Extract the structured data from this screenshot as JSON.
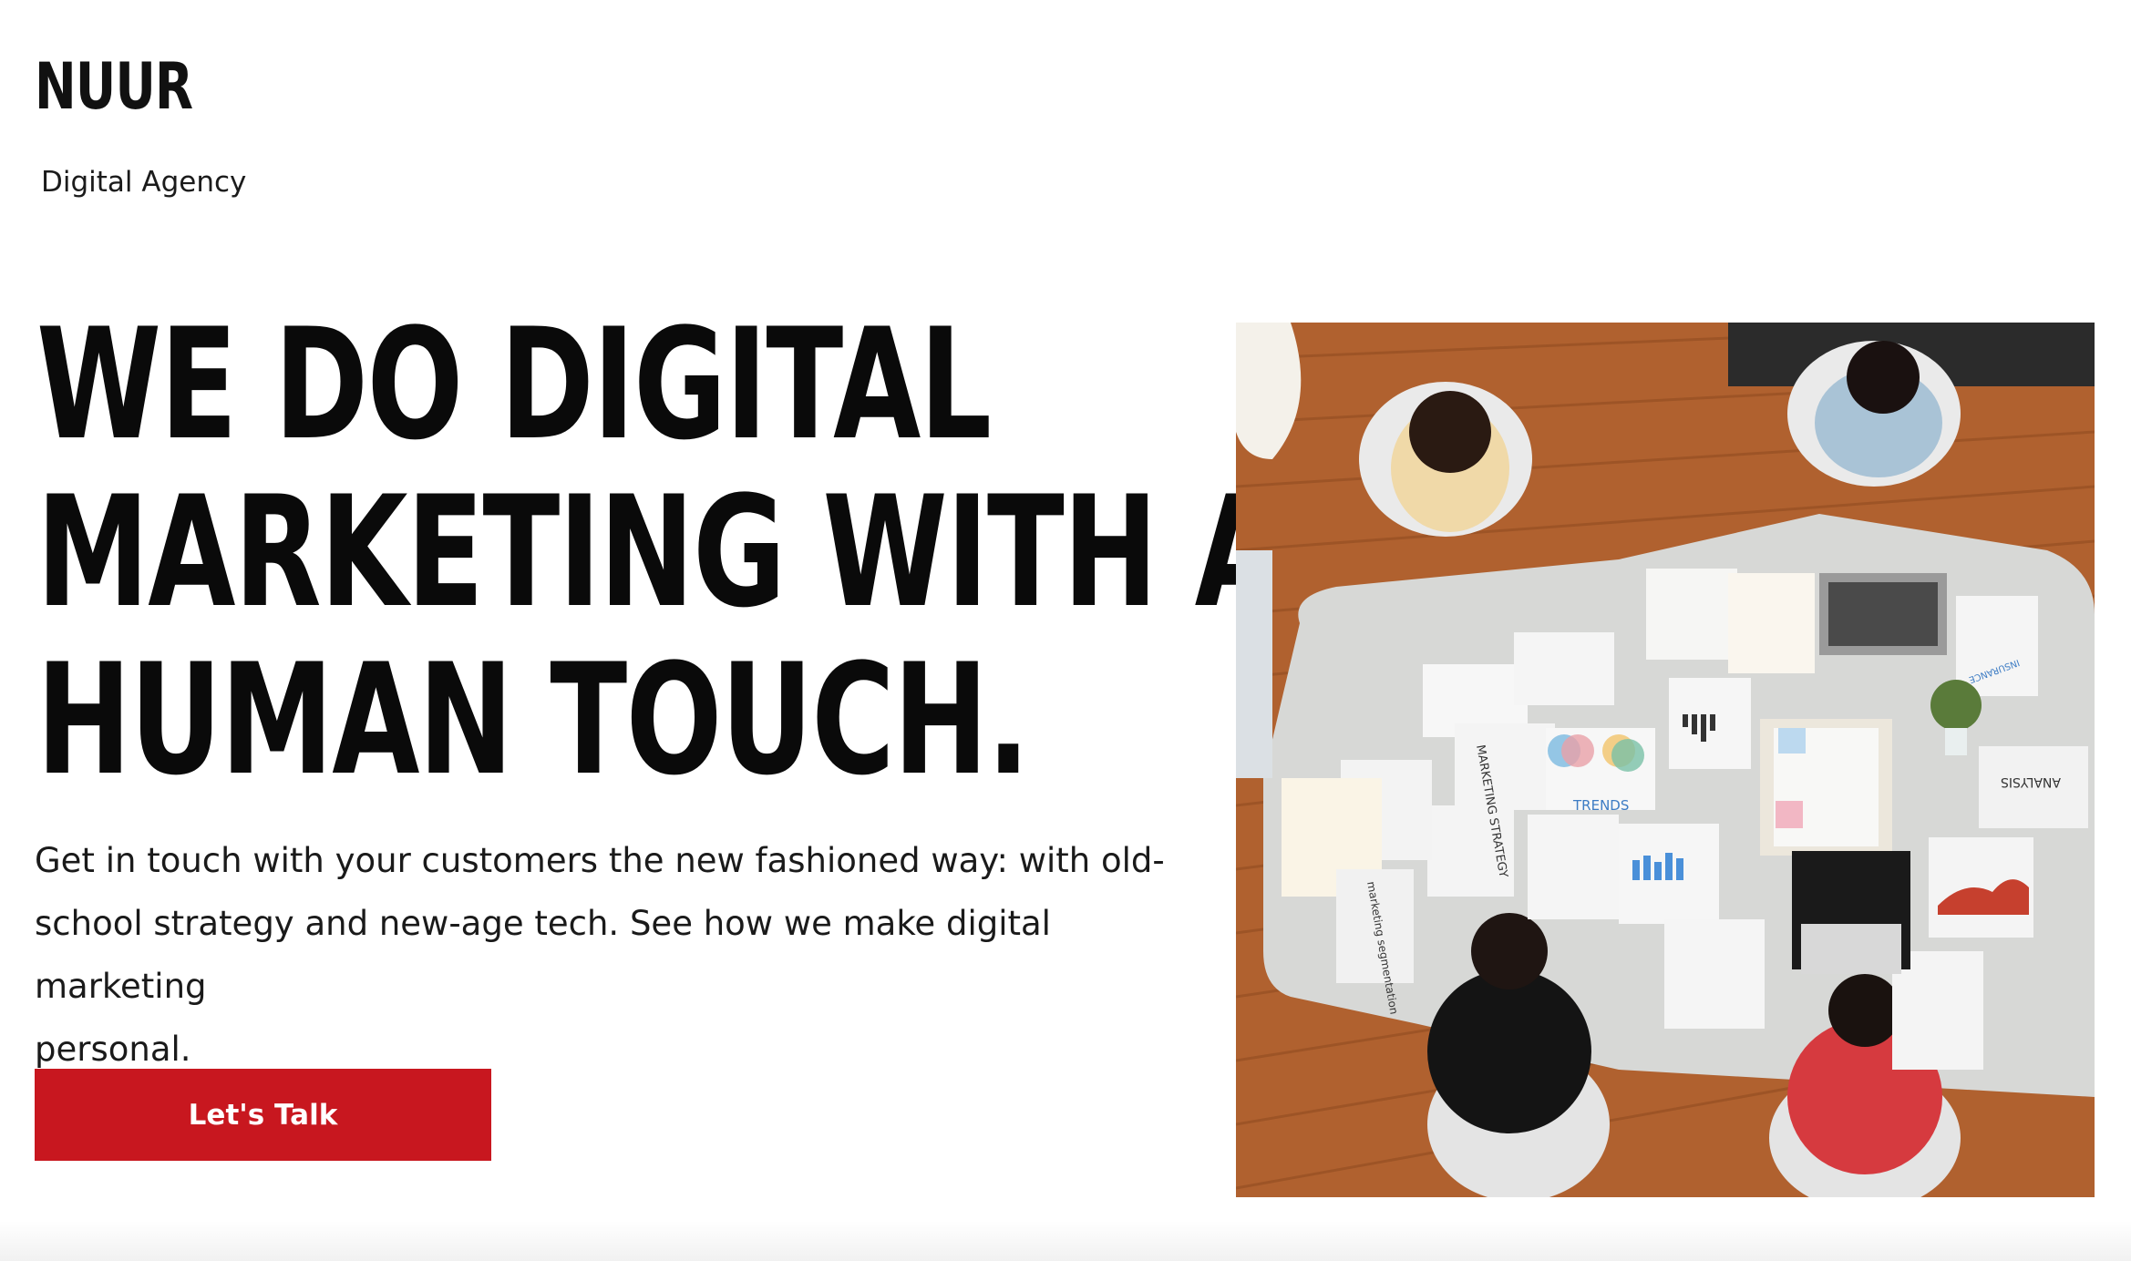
{
  "header": {
    "brand": "NUUR",
    "tagline": "Digital Agency"
  },
  "hero": {
    "headline_lines": [
      "WE DO DIGITAL",
      "MARKETING WITH A",
      "HUMAN TOUCH."
    ],
    "subtext_lines": [
      "Get in touch with your customers the new fashioned way: with old-",
      "school strategy and new-age tech. See how we make digital marketing",
      "personal."
    ],
    "cta_label": "Let's Talk"
  },
  "image": {
    "description_icon": "team-meeting-photo",
    "paper_labels": {
      "marketing_strategy": "MARKETING STRATEGY",
      "trends": "TRENDS",
      "analysis": "ANALYSIS",
      "insurance": "INSURANCE",
      "segmentation": "marketing segmentation"
    }
  },
  "colors": {
    "accent": "#c8171f",
    "text": "#0a0a0a",
    "background": "#ffffff"
  }
}
